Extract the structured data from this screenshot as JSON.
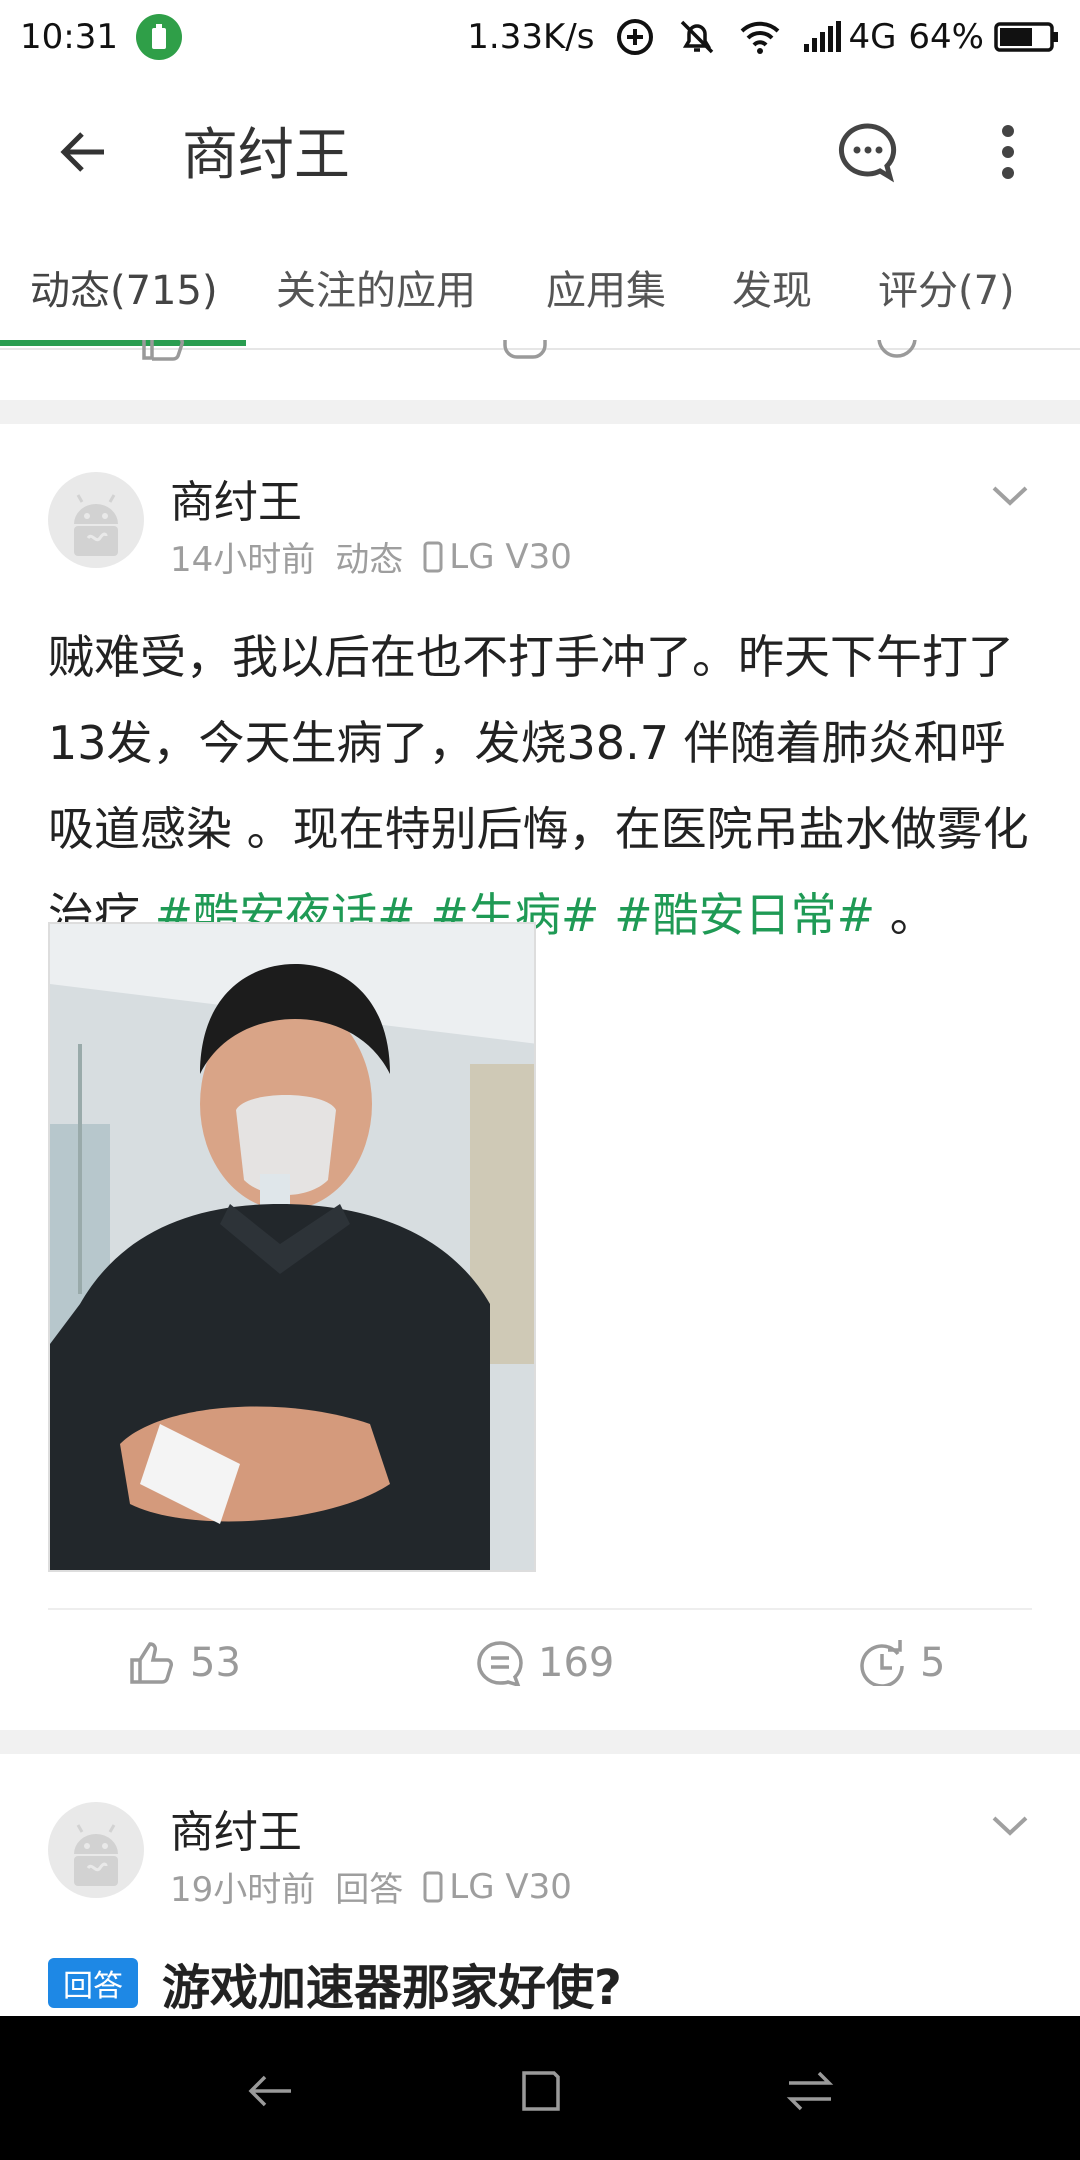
{
  "status_bar": {
    "time": "10:31",
    "net_speed": "1.33K/s",
    "network": "4G",
    "battery": "64%"
  },
  "app_bar": {
    "title": "商纣王",
    "back_icon": "arrow-left-icon",
    "chat_icon": "chat-bubble-icon",
    "more_icon": "more-vertical-icon"
  },
  "tabs": [
    {
      "label": "动态(715)",
      "active": true
    },
    {
      "label": "关注的应用"
    },
    {
      "label": "应用集"
    },
    {
      "label": "发现"
    },
    {
      "label": "评分(7)"
    }
  ],
  "colors": {
    "accent": "#2a9d50",
    "tag": "#1f9a55",
    "badge": "#1e88e5"
  },
  "post1": {
    "author": "商纣王",
    "time": "14小时前",
    "type": "动态",
    "device": "LG V30",
    "text_main": "贼难受，我以后在也不打手冲了。昨天下午打了13发，今天生病了，发烧38.7 伴随着肺炎和呼吸道感染 。现在特别后悔，在医院吊盐水做雾化治疗 ",
    "tags": [
      "#酷安夜话#",
      "#生病#",
      "#酷安日常#"
    ],
    "text_end": " 。",
    "likes": "53",
    "comments": "169",
    "shares": "5"
  },
  "post2": {
    "author": "商纣王",
    "time": "19小时前",
    "type": "回答",
    "device": "LG V30",
    "badge": "回答",
    "title": "游戏加速器那家好使?"
  }
}
